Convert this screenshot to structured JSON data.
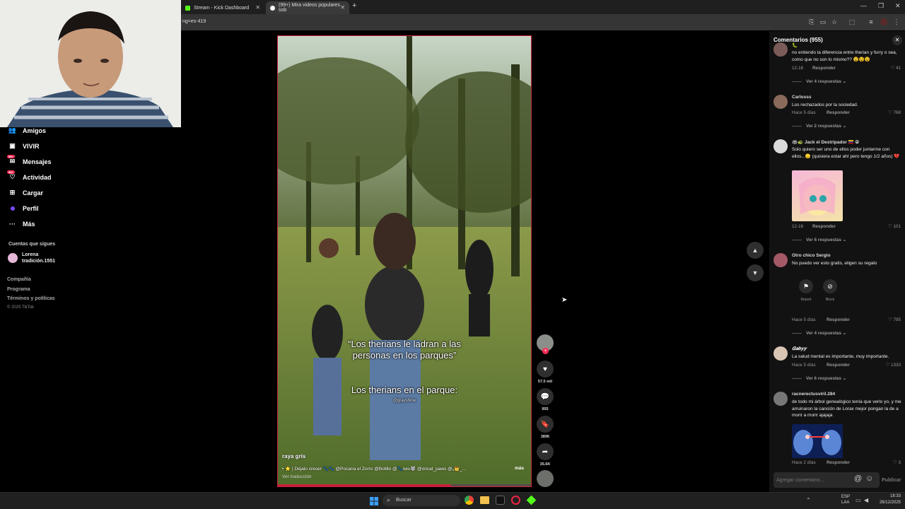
{
  "browser": {
    "tabs": [
      {
        "label": "Stream - Kick Dashboard",
        "color": "#53fc18"
      },
      {
        "label": "(99+) Mira videos populares sob",
        "color": "#ffffff"
      }
    ],
    "url_fragment": "ng=es-419"
  },
  "sidebar": {
    "items": [
      {
        "label": "Amigos",
        "icon": "friends-icon"
      },
      {
        "label": "VIVIR",
        "icon": "live-icon"
      },
      {
        "label": "Mensajes",
        "icon": "messages-icon",
        "badge": "99+"
      },
      {
        "label": "Actividad",
        "icon": "activity-icon",
        "badge": "99+"
      },
      {
        "label": "Cargar",
        "icon": "upload-icon"
      },
      {
        "label": "Perfil",
        "icon": "profile-icon"
      },
      {
        "label": "Más",
        "icon": "more-icon"
      }
    ],
    "following_title": "Cuentas que sigues",
    "following": [
      {
        "name": "Lorena",
        "handle": "tradición.1551"
      }
    ],
    "footer": [
      "Compañía",
      "Programa",
      "Términos y políticas",
      "© 2025 TikTok"
    ]
  },
  "video": {
    "caption_top": "“Los therians le ladran a las personas en los parques”",
    "caption_mid": "Los therians en el parque:",
    "watermark": "@grayshine",
    "author": "raya gris",
    "description": "• ⭐ | Déjalo crecer 🐾🐾 @Pocana el Zorro @Bolillo @🐾nev🐺 @oricat_paws @ᵤ👑_...",
    "more": "más",
    "translate": "Ver traducción",
    "progress": 0.68
  },
  "actions": {
    "likes": "57.5 mil",
    "comments": "955",
    "saves": "3896",
    "shares": "35.6K"
  },
  "comments_panel": {
    "title": "Comentarios (955)",
    "input_placeholder": "Agregar comentario...",
    "post_label": "Publicar",
    "report_label": "Report",
    "block_label": "Block",
    "reply_label": "Responder",
    "items": [
      {
        "user": "🐛",
        "text": "no entiendo la diferencia entre therian y furry o sea, como que no son lo mismo?? 😵😵😵",
        "date": "12-16",
        "likes": "41",
        "more": "Ver 4 respuestas"
      },
      {
        "user": "Carlosss",
        "text": "Los rechazados por la sociedad.",
        "date": "Hace 5 días",
        "likes": "768",
        "more": "Ver 2 respuestas"
      },
      {
        "user": "🦝🐢 Jack el Destripador 🇻🇪 🕀",
        "text": "Solo quiero ser uno de ellos poder juntarme con ellos...😞 (quisiera estar ahí pero tengo 1/2 años) 💔",
        "date": "12-16",
        "likes": "101",
        "more": "Ver 6 respuestas"
      },
      {
        "user": "Otro chico Sergio",
        "text": "No puedo ver esto gratis, eligen su regalo",
        "date": "Hace 5 días",
        "likes": "795",
        "more": "Ver 4 respuestas"
      },
      {
        "user": "𝑮𝒂𝒃𝒚𝒚",
        "text": "La salud mental es importante, muy importante.",
        "date": "Hace 5 días",
        "likes": "1333",
        "more": "Ver 6 respuestas"
      },
      {
        "user": "racnerectusviril.284",
        "text": "de todo mi árbol genealógico tenía que verlo yo, y me arruinaron la canción de Lorax mejor pongan la de a morir a morir ajajaja",
        "date": "Hace 2 días",
        "likes": "3"
      }
    ]
  },
  "taskbar": {
    "search_label": "Buscar",
    "lang": "ESP",
    "lang_sub": "LAA",
    "time": "18:33",
    "date": "26/12/2025"
  }
}
